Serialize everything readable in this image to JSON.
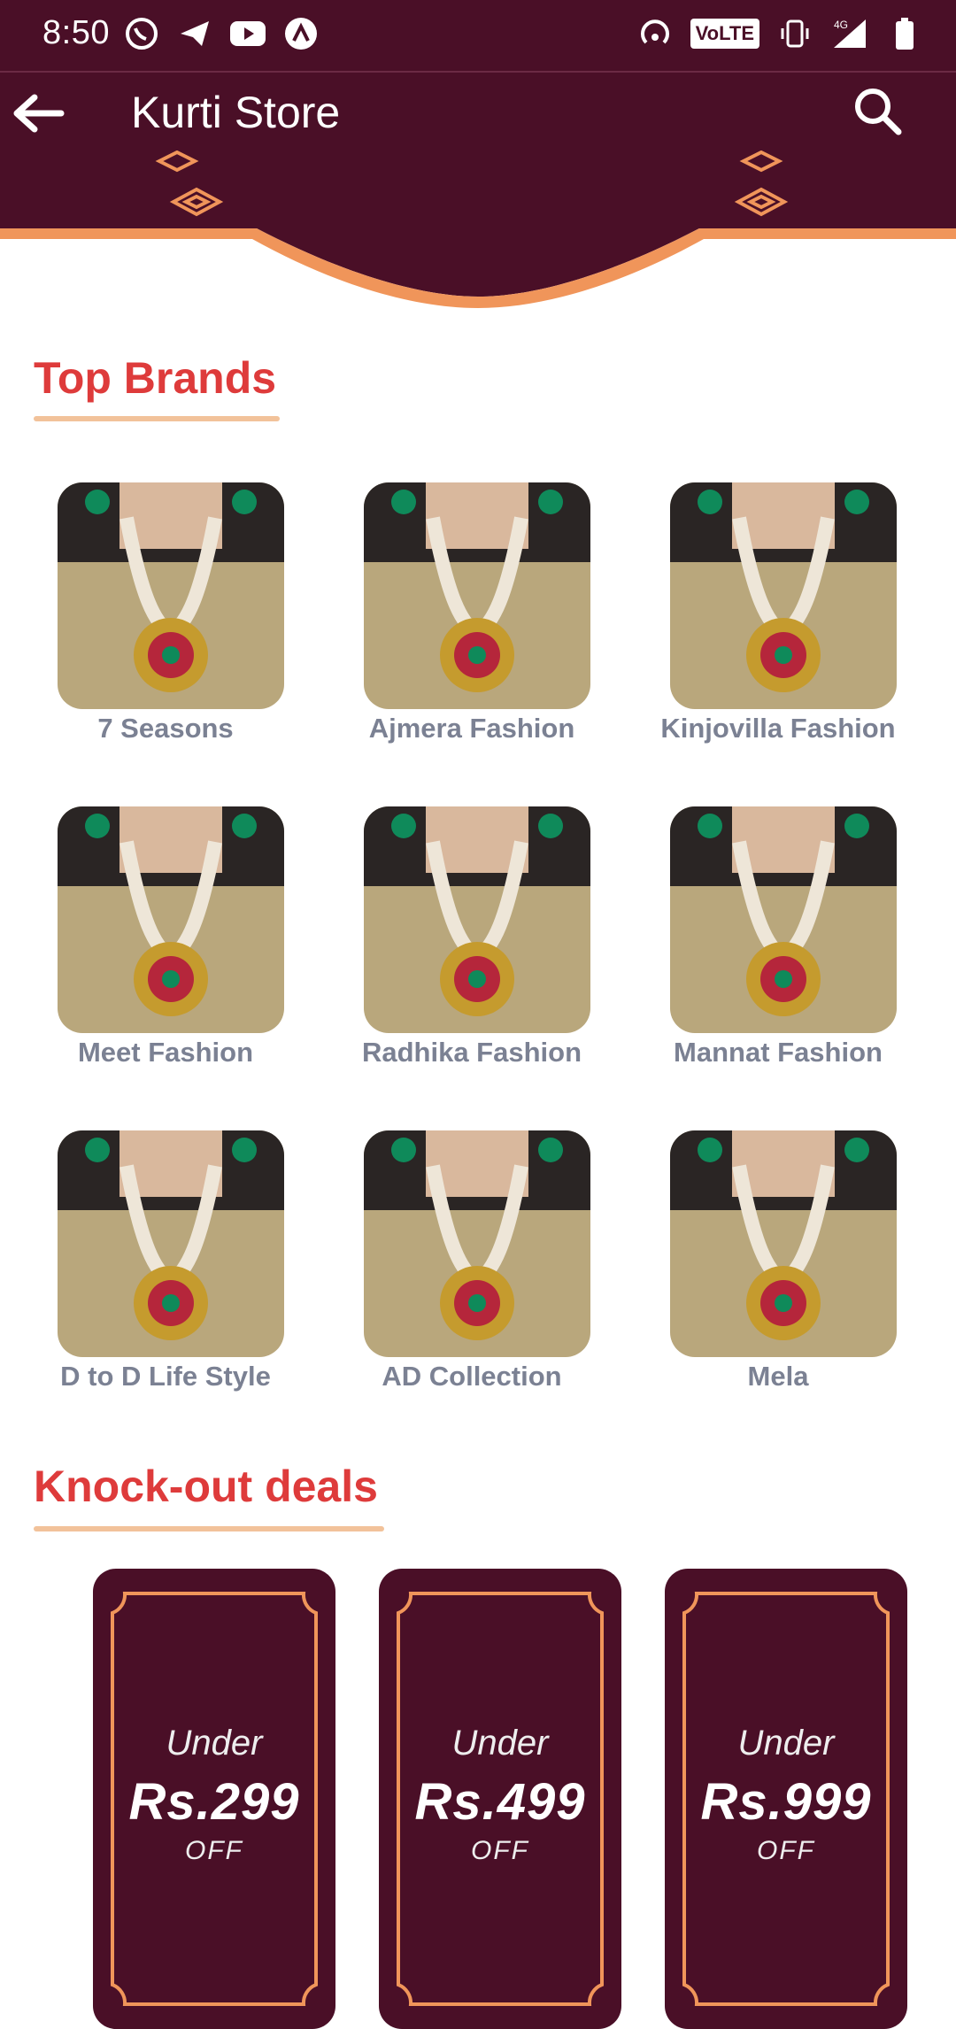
{
  "status_bar": {
    "time": "8:50",
    "left_icons": [
      "whatsapp-icon",
      "telegram-icon",
      "youtube-icon",
      "arrow-app-icon"
    ],
    "right_icons": [
      "hotspot-icon",
      "volte-badge",
      "vibrate-icon",
      "signal-4g-icon",
      "battery-icon"
    ],
    "volte_label": "VoLTE",
    "network_label": "4G"
  },
  "app_bar": {
    "title": "Kurti Store",
    "back_icon": "arrow-left-icon",
    "search_icon": "search-icon"
  },
  "sections": {
    "top_brands": {
      "title": "Top Brands",
      "brands": [
        {
          "name": "7 Seasons"
        },
        {
          "name": "Ajmera Fashion"
        },
        {
          "name": "Kinjovilla Fashion"
        },
        {
          "name": "Meet Fashion"
        },
        {
          "name": "Radhika Fashion"
        },
        {
          "name": "Mannat Fashion"
        },
        {
          "name": "D to D Life Style"
        },
        {
          "name": "AD Collection"
        },
        {
          "name": "Mela"
        }
      ]
    },
    "knockout_deals": {
      "title": "Knock-out deals",
      "deals": [
        {
          "under": "Under",
          "price": "Rs.299",
          "off": "OFF"
        },
        {
          "under": "Under",
          "price": "Rs.499",
          "off": "OFF"
        },
        {
          "under": "Under",
          "price": "Rs.999",
          "off": "OFF"
        }
      ]
    }
  },
  "colors": {
    "primary": "#4a0f27",
    "accent_orange": "#f0955a",
    "section_title": "#de3b3b",
    "brand_label": "#7b8193",
    "underline": "#f2c29a"
  }
}
